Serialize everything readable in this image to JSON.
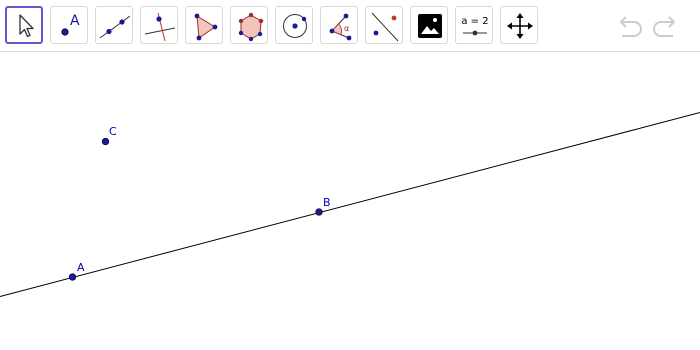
{
  "toolbar": {
    "tools": [
      {
        "name": "move",
        "icon": "move-cursor-icon",
        "selected": true
      },
      {
        "name": "point",
        "icon": "point-icon",
        "label": "A"
      },
      {
        "name": "line",
        "icon": "line-icon"
      },
      {
        "name": "perpendicular-line",
        "icon": "perpendicular-line-icon"
      },
      {
        "name": "polygon",
        "icon": "polygon-icon"
      },
      {
        "name": "regular-polygon",
        "icon": "regular-polygon-icon"
      },
      {
        "name": "circle",
        "icon": "circle-icon"
      },
      {
        "name": "angle",
        "icon": "angle-icon",
        "label": "α"
      },
      {
        "name": "reflect",
        "icon": "reflect-about-line-icon"
      },
      {
        "name": "image",
        "icon": "image-icon"
      },
      {
        "name": "slider",
        "icon": "slider-icon",
        "label": "a = 2"
      },
      {
        "name": "move-graphics-view",
        "icon": "move-graphics-view-icon"
      }
    ],
    "undo": {
      "icon": "undo-icon",
      "enabled": false
    },
    "redo": {
      "icon": "redo-icon",
      "enabled": false
    }
  },
  "colors": {
    "accent": "#6557d2",
    "point": "#1a1a99",
    "label": "#0000b3",
    "line": "#000000",
    "polygon_fill": "#f2c4bb",
    "polygon_vertex": "#a02c2c",
    "disabled": "#cccccc"
  },
  "construction": {
    "points": [
      {
        "name": "A",
        "label": "A"
      },
      {
        "name": "B",
        "label": "B"
      },
      {
        "name": "C",
        "label": "C"
      }
    ],
    "line": {
      "through": [
        "A",
        "B"
      ]
    }
  }
}
